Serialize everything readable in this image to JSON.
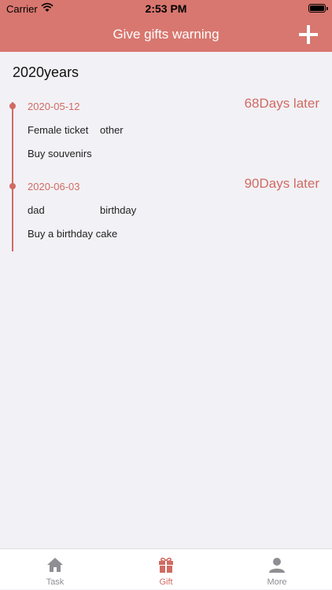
{
  "status_bar": {
    "carrier": "Carrier",
    "time": "2:53 PM"
  },
  "nav": {
    "title": "Give gifts warning"
  },
  "year_title": "2020years",
  "events": [
    {
      "date": "2020-05-12",
      "days": "68Days later",
      "person": "Female ticket",
      "type": "other",
      "note": "Buy souvenirs"
    },
    {
      "date": "2020-06-03",
      "days": "90Days later",
      "person": "dad",
      "type": "birthday",
      "note": "Buy a birthday cake"
    }
  ],
  "tabs": [
    {
      "label": "Task",
      "icon": "home-icon",
      "active": false
    },
    {
      "label": "Gift",
      "icon": "gift-icon",
      "active": true
    },
    {
      "label": "More",
      "icon": "user-icon",
      "active": false
    }
  ],
  "colors": {
    "accent": "#d8776f",
    "accent_text": "#d06b62",
    "inactive": "#8e8e93",
    "background": "#f2f1f6"
  }
}
